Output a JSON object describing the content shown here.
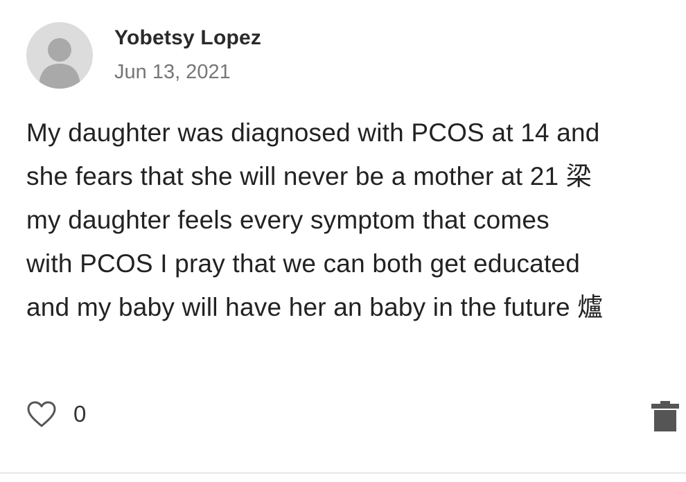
{
  "post": {
    "author": "Yobetsy Lopez",
    "date": "Jun 13, 2021",
    "body": "My daughter was diagnosed with PCOS at 14 and\nshe fears that she will never be a mother at 21 梁\nmy daughter feels every symptom that comes\nwith PCOS I pray that we can both get educated\nand my baby will have her an baby in the future 爐"
  },
  "actions": {
    "like_icon": "heart-outline-icon",
    "like_count": "0",
    "delete_icon": "trash-icon"
  },
  "colors": {
    "avatar_bg": "#dcdcdc",
    "avatar_fg": "#a9a9a9",
    "icon_gray": "#555555"
  }
}
